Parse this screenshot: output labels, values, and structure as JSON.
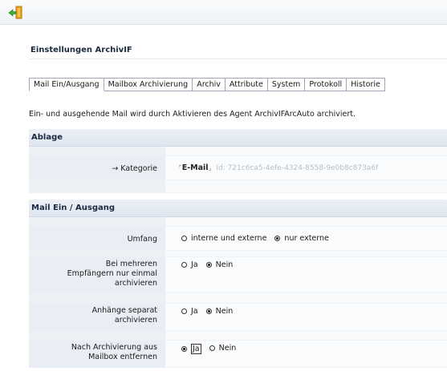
{
  "toolbar": {
    "exit_icon": "exit-icon"
  },
  "page": {
    "title": "Einstellungen ArchivIF"
  },
  "tabs": [
    {
      "label": "Mail Ein/Ausgang",
      "active": true
    },
    {
      "label": "Mailbox Archivierung",
      "active": false
    },
    {
      "label": "Archiv",
      "active": false
    },
    {
      "label": "Attribute",
      "active": false
    },
    {
      "label": "System",
      "active": false
    },
    {
      "label": "Protokoll",
      "active": false
    },
    {
      "label": "Historie",
      "active": false
    }
  ],
  "description": "Ein- und ausgehende Mail wird durch Aktivieren des Agent ArchivIFArcAuto archiviert.",
  "ablage": {
    "heading": "Ablage",
    "kategorie_label": "→ Kategorie",
    "kategorie_value": "E-Mail",
    "kategorie_id": "Id: 721c6ca5-4efe-4324-8558-9e0b8c873a6f"
  },
  "mail": {
    "heading": "Mail Ein / Ausgang",
    "umfang_label": "Umfang",
    "umfang_options": [
      "interne und externe",
      "nur externe"
    ],
    "umfang_selected": "nur externe",
    "empf_label_1": "Bei mehreren",
    "empf_label_2": "Empfängern nur einmal",
    "empf_label_3": "archivieren",
    "empf_options": [
      "Ja",
      "Nein"
    ],
    "empf_selected": "Nein",
    "anh_label_1": "Anhänge separat",
    "anh_label_2": "archivieren",
    "anh_options": [
      "Ja",
      "Nein"
    ],
    "anh_selected": "Nein",
    "nach_label_1": "Nach Archivierung aus",
    "nach_label_2": "Mailbox entfernen",
    "nach_options": [
      "Ja",
      "Nein"
    ],
    "nach_selected": "Ja"
  }
}
